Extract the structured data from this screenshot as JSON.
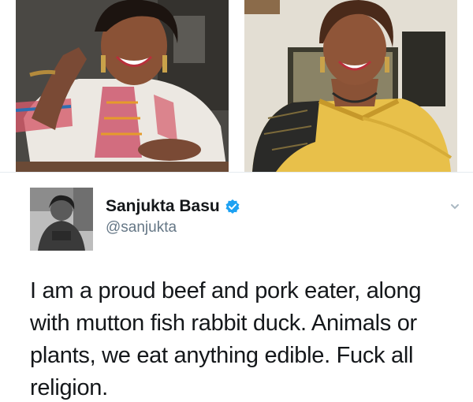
{
  "tweet": {
    "display_name": "Sanjukta Basu",
    "handle": "@sanjukta",
    "verified": true,
    "text": "I am a proud beef and pork eater, along\nwith mutton fish rabbit duck. Animals or\nplants, we eat anything edible. Fuck all\nreligion."
  },
  "colors": {
    "name": "#14171a",
    "handle": "#657786",
    "verified_badge": "#1da1f2",
    "divider": "#e6ecf0",
    "saree_yellow": "#e8c04a"
  },
  "icons": {
    "verified": "verified-badge-icon",
    "menu": "chevron-down-icon"
  }
}
